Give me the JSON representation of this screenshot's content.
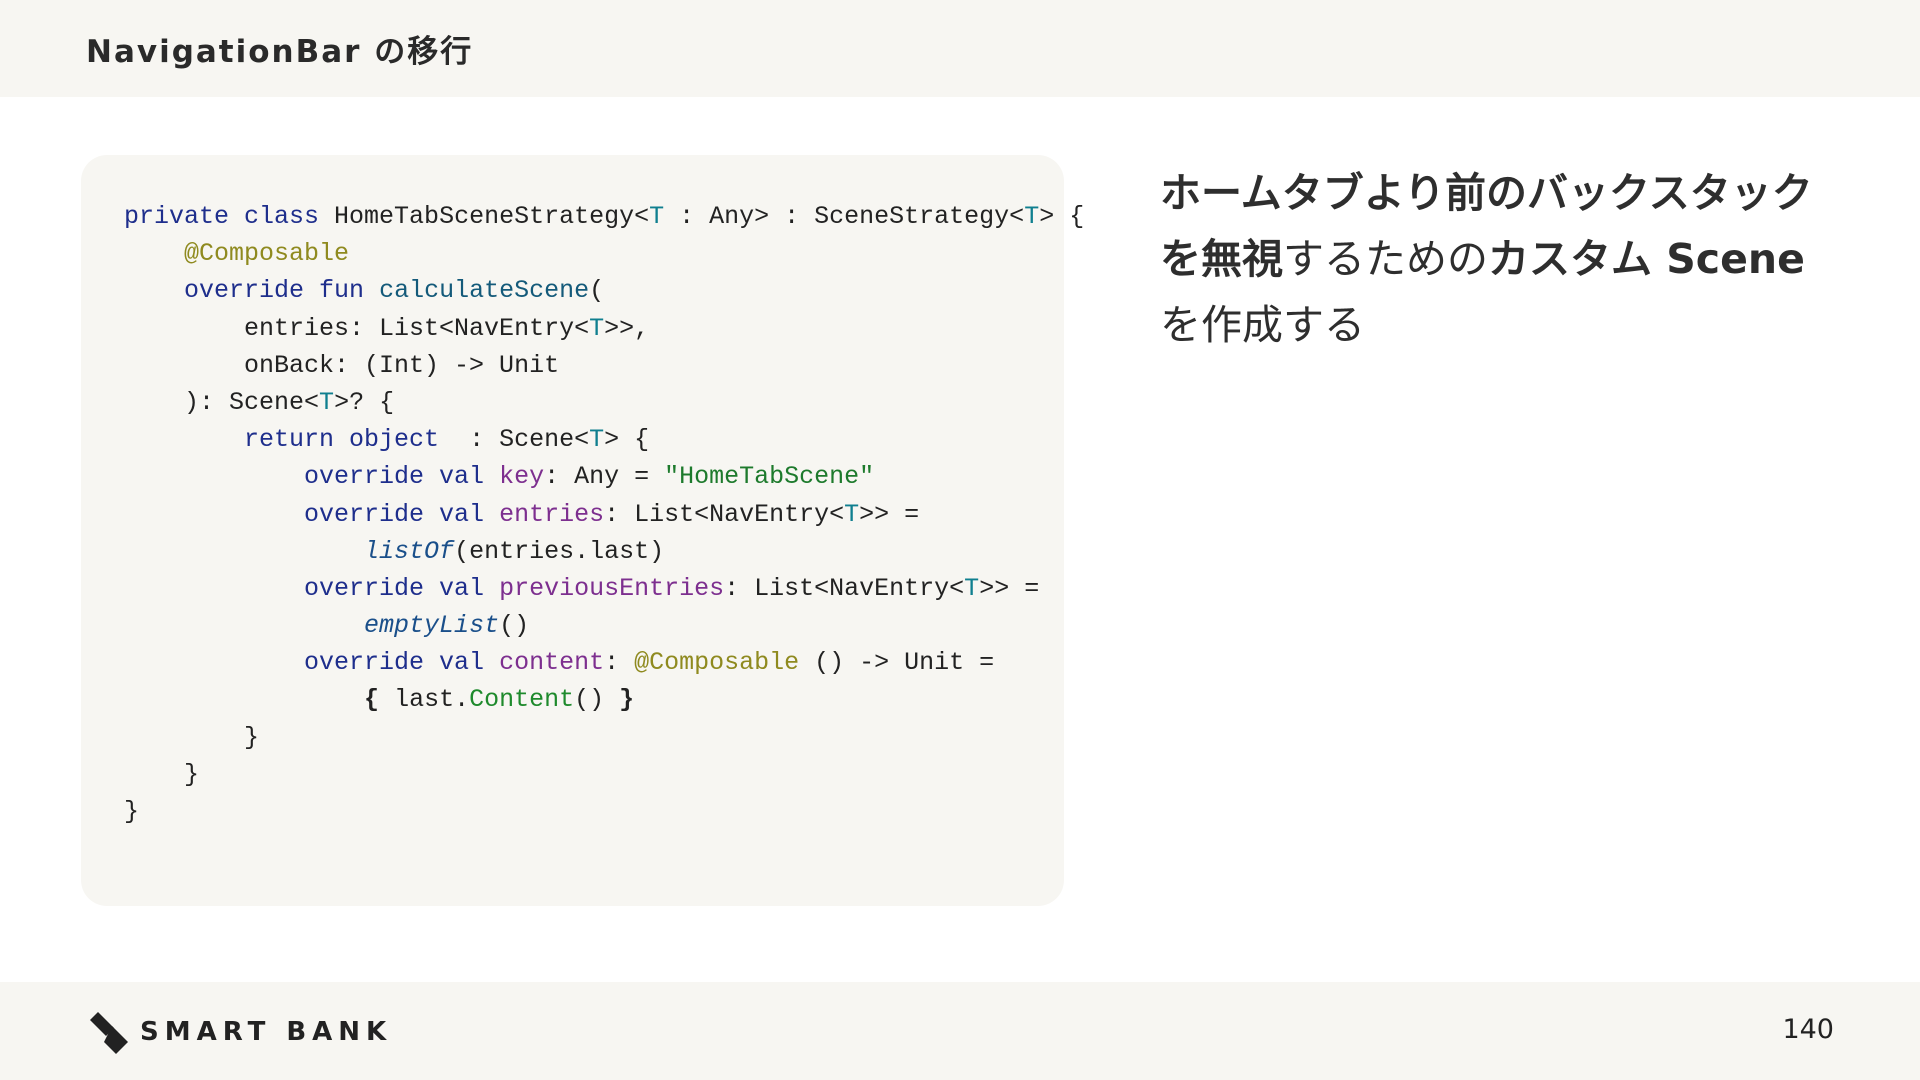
{
  "header": {
    "title": "NavigationBar の移行"
  },
  "code": {
    "lines": [
      [
        [
          "kw",
          "private class "
        ],
        [
          "",
          "HomeTabSceneStrategy<"
        ],
        [
          "ty",
          "T"
        ],
        [
          "",
          " : Any> : SceneStrategy<"
        ],
        [
          "ty",
          "T"
        ],
        [
          "",
          "> {"
        ]
      ],
      [
        [
          "",
          "    "
        ],
        [
          "ann",
          "@Composable"
        ]
      ],
      [
        [
          "",
          "    "
        ],
        [
          "kw",
          "override fun "
        ],
        [
          "fn",
          "calculateScene"
        ],
        [
          "",
          "("
        ]
      ],
      [
        [
          "",
          "        entries: List<NavEntry<"
        ],
        [
          "ty",
          "T"
        ],
        [
          "",
          ">>,"
        ]
      ],
      [
        [
          "",
          "        onBack: (Int) -> Unit"
        ]
      ],
      [
        [
          "",
          "    ): Scene<"
        ],
        [
          "ty",
          "T"
        ],
        [
          "",
          ">? {"
        ]
      ],
      [
        [
          "",
          "        "
        ],
        [
          "kw",
          "return object "
        ],
        [
          "",
          " : Scene<"
        ],
        [
          "ty",
          "T"
        ],
        [
          "",
          "> {"
        ]
      ],
      [
        [
          "",
          "            "
        ],
        [
          "kw",
          "override val "
        ],
        [
          "prop",
          "key"
        ],
        [
          "",
          ": Any = "
        ],
        [
          "str",
          "\"HomeTabScene\""
        ]
      ],
      [
        [
          "",
          "            "
        ],
        [
          "kw",
          "override val "
        ],
        [
          "prop",
          "entries"
        ],
        [
          "",
          ": List<NavEntry<"
        ],
        [
          "ty",
          "T"
        ],
        [
          "",
          ">> ="
        ]
      ],
      [
        [
          "",
          "                "
        ],
        [
          "it",
          "listOf"
        ],
        [
          "",
          "(entries.last)"
        ]
      ],
      [
        [
          "",
          "            "
        ],
        [
          "kw",
          "override val "
        ],
        [
          "prop",
          "previousEntries"
        ],
        [
          "",
          ": List<NavEntry<"
        ],
        [
          "ty",
          "T"
        ],
        [
          "",
          ">> ="
        ]
      ],
      [
        [
          "",
          "                "
        ],
        [
          "it",
          "emptyList"
        ],
        [
          "",
          "()"
        ]
      ],
      [
        [
          "",
          "            "
        ],
        [
          "kw",
          "override val "
        ],
        [
          "prop",
          "content"
        ],
        [
          "",
          ": "
        ],
        [
          "ann",
          "@Composable"
        ],
        [
          "",
          " () -> Unit ="
        ]
      ],
      [
        [
          "",
          "                "
        ],
        [
          "br",
          "{"
        ],
        [
          "",
          " last."
        ],
        [
          "call",
          "Content"
        ],
        [
          "",
          "() "
        ],
        [
          "br",
          "}"
        ]
      ],
      [
        [
          "",
          "        }"
        ]
      ],
      [
        [
          "",
          "    }"
        ]
      ],
      [
        [
          "",
          "}"
        ]
      ]
    ]
  },
  "explanation": {
    "part1": "ホームタブより前のバックスタックを無視",
    "part2": "するための",
    "part3": "カスタム Scene",
    "part4": " を作成する"
  },
  "footer": {
    "logo_text": "SMART BANK",
    "page_number": "140"
  }
}
